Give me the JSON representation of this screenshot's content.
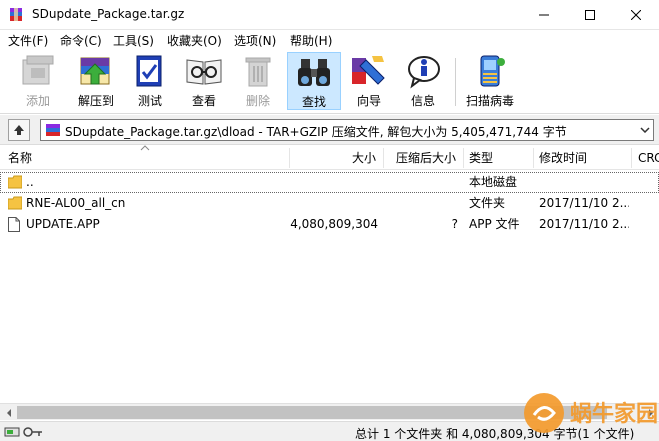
{
  "window": {
    "title": "SDupdate_Package.tar.gz",
    "minimize_icon": "minimize-icon",
    "maximize_icon": "maximize-icon",
    "close_icon": "close-icon"
  },
  "menu": {
    "items": [
      "文件(F)",
      "命令(C)",
      "工具(S)",
      "收藏夹(O)",
      "选项(N)",
      "帮助(H)"
    ]
  },
  "toolbar": {
    "buttons": [
      {
        "label": "添加",
        "icon": "add-archive-icon",
        "enabled": false
      },
      {
        "label": "解压到",
        "icon": "extract-icon",
        "enabled": true
      },
      {
        "label": "测试",
        "icon": "test-icon",
        "enabled": true
      },
      {
        "label": "查看",
        "icon": "view-icon",
        "enabled": true
      },
      {
        "label": "删除",
        "icon": "delete-icon",
        "enabled": false
      },
      {
        "label": "查找",
        "icon": "find-binoculars-icon",
        "enabled": true,
        "active": true
      },
      {
        "label": "向导",
        "icon": "wizard-icon",
        "enabled": true
      },
      {
        "label": "信息",
        "icon": "info-icon",
        "enabled": true
      },
      {
        "label": "扫描病毒",
        "icon": "virus-scan-icon",
        "enabled": true
      }
    ]
  },
  "pathbar": {
    "path": "SDupdate_Package.tar.gz\\dload - TAR+GZIP 压缩文件, 解包大小为 5,405,471,744 字节"
  },
  "columns": [
    "名称",
    "大小",
    "压缩后大小",
    "类型",
    "修改时间",
    "CRC"
  ],
  "rows": [
    {
      "name": "..",
      "size": "",
      "packed": "",
      "type": "本地磁盘",
      "modified": "",
      "icon": "folder-up-icon"
    },
    {
      "name": "RNE-AL00_all_cn",
      "size": "",
      "packed": "",
      "type": "文件夹",
      "modified": "2017/11/10 2...",
      "icon": "folder-icon"
    },
    {
      "name": "UPDATE.APP",
      "size": "4,080,809,304",
      "packed": "?",
      "type": "APP 文件",
      "modified": "2017/11/10 2...",
      "icon": "file-icon"
    }
  ],
  "status": {
    "text": "总计 1 个文件夹 和 4,080,809,304 字节(1 个文件)"
  },
  "watermark": {
    "text": "蜗牛家园"
  },
  "colors": {
    "folder": "#f5c342",
    "accent": "#cce8ff",
    "watermark": "#f39a2c"
  }
}
